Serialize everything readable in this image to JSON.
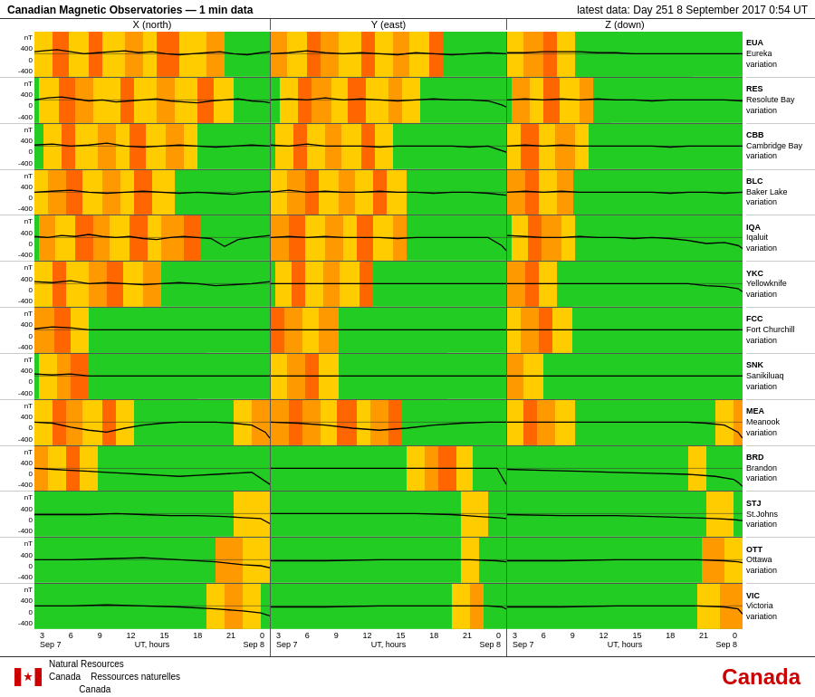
{
  "header": {
    "title": "Canadian Magnetic Observatories — 1 min data",
    "latest": "latest data: Day 251   8 September 2017   0:54 UT"
  },
  "columns": [
    "X (north)",
    "Y (east)",
    "Z (down)"
  ],
  "stations": [
    {
      "code": "EUA",
      "name": "Eureka",
      "type": "variation"
    },
    {
      "code": "RES",
      "name": "Resolute Bay",
      "type": "variation"
    },
    {
      "code": "CBB",
      "name": "Cambridge Bay",
      "type": "variation"
    },
    {
      "code": "BLC",
      "name": "Baker Lake",
      "type": "variation"
    },
    {
      "code": "IQA",
      "name": "Iqaluit",
      "type": "variation"
    },
    {
      "code": "YKC",
      "name": "Yellowknife",
      "type": "variation"
    },
    {
      "code": "FCC",
      "name": "Fort Churchill",
      "type": "variation"
    },
    {
      "code": "SNK",
      "name": "Sanikiluaq",
      "type": "variation"
    },
    {
      "code": "MEA",
      "name": "Meanook",
      "type": "variation"
    },
    {
      "code": "BRD",
      "name": "Brandon",
      "type": "variation"
    },
    {
      "code": "STJ",
      "name": "St.Johns",
      "type": "variation"
    },
    {
      "code": "OTT",
      "name": "Ottawa",
      "type": "variation"
    },
    {
      "code": "VIC",
      "name": "Victoria",
      "type": "variation"
    }
  ],
  "x_axis": {
    "labels": [
      "3",
      "6",
      "9",
      "12",
      "15",
      "18",
      "21",
      "0"
    ],
    "start": "Sep 7",
    "end": "Sep 8",
    "unit": "UT, hours"
  },
  "y_axis": {
    "labels": [
      "400",
      "0",
      "-400"
    ]
  },
  "footer": {
    "org_en": "Natural Resources",
    "org_en2": "Canada",
    "org_fr": "Ressources naturelles",
    "org_fr2": "Canada",
    "brand": "Canada"
  }
}
